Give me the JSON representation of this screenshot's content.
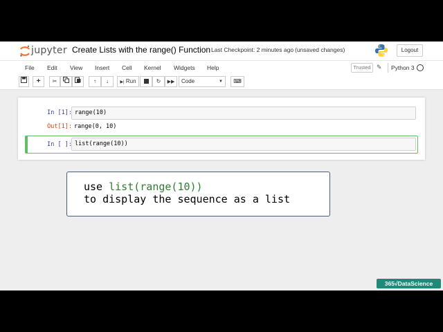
{
  "header": {
    "logo_text": "jupyter",
    "notebook_title": "Create Lists with the range() Function",
    "checkpoint": "Last Checkpoint: 2 minutes ago",
    "unsaved": "(unsaved changes)",
    "logout_label": "Logout"
  },
  "menubar": {
    "items": [
      "File",
      "Edit",
      "View",
      "Insert",
      "Cell",
      "Kernel",
      "Widgets",
      "Help"
    ],
    "trusted": "Trusted",
    "kernel": "Python 3"
  },
  "toolbar": {
    "run_label": "Run",
    "cell_type": "Code"
  },
  "cells": [
    {
      "in_prompt": "In [1]:",
      "code": "range(10)",
      "out_prompt": "Out[1]:",
      "output": "range(0, 10)"
    },
    {
      "in_prompt": "In [ ]:",
      "code": "list(range(10))"
    }
  ],
  "caption": {
    "prefix": "use ",
    "code": "list(range(10))",
    "line2": "to display the sequence as a list"
  },
  "brand": "365√DataScience",
  "colors": {
    "jupyter_orange": "#f37726",
    "selected_cell": "#66bb6a",
    "brand": "#1f8a7a"
  }
}
